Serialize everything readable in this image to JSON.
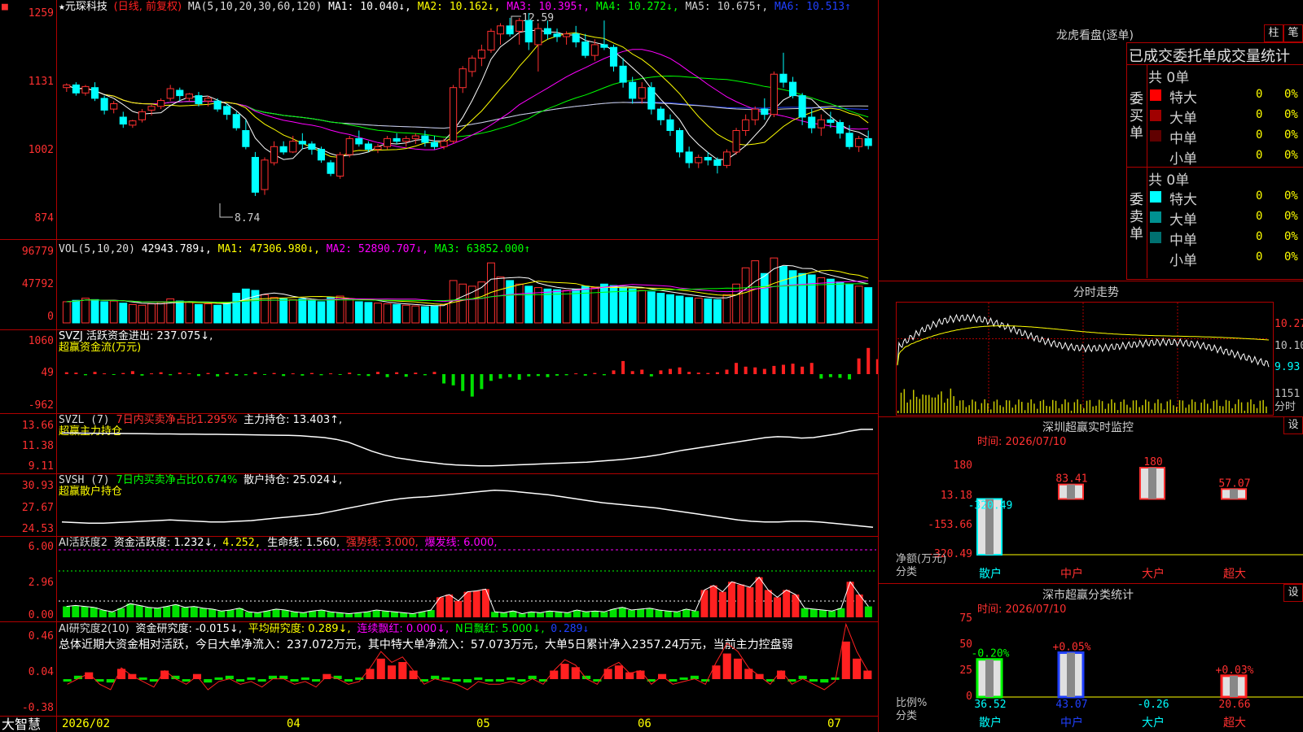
{
  "main_header": {
    "star": "★",
    "name": "元琛科技",
    "period": "(日线, 前复权)",
    "ma_label": "MA(5,10,20,30,60,120)",
    "ma1": "MA1: 10.040↓,",
    "ma2": "MA2: 10.162↓,",
    "ma3": "MA3: 10.395↑,",
    "ma4": "MA4: 10.272↓,",
    "ma5": "MA5: 10.675↑,",
    "ma6": "MA6: 10.513↑",
    "high_note": "12.59",
    "low_note": "8.74"
  },
  "price_axis": [
    "1259",
    "1131",
    "1002",
    "874"
  ],
  "vol_header": {
    "label": "VOL(5,10,20)",
    "value": "42943.789↓,",
    "ma1": "MA1: 47306.980↓,",
    "ma2": "MA2: 52890.707↓,",
    "ma3": "MA3: 63852.000↑"
  },
  "vol_axis": [
    "96779",
    "47792",
    "0"
  ],
  "svzj": {
    "line1": "SVZJ  活跃资金进出: 237.075↓,",
    "line2": "超赢资金流(万元)",
    "axis": [
      "1060",
      "49",
      "-962"
    ]
  },
  "svzl": {
    "label": "SVZL (7)",
    "net": "7日内买卖净占比1.295%",
    "hold": "主力持仓: 13.403↑,",
    "line2": "超赢主力持仓",
    "axis": [
      "13.66",
      "11.38",
      "9.11"
    ]
  },
  "svsh": {
    "label": "SVSH (7)",
    "net": "7日内买卖净占比0.674%",
    "hold": "散户持仓: 25.024↓,",
    "line2": "超赢散户持仓",
    "axis": [
      "30.93",
      "27.67",
      "24.53"
    ]
  },
  "ai_active": {
    "label": "AI活跃度2",
    "v1": "资金活跃度: 1.232↓,",
    "v2": "4.252,",
    "v3": "生命线: 1.560,",
    "v4": "强势线: 3.000,",
    "v5": "爆发线: 6.000,",
    "axis": [
      "6.00",
      "2.96",
      "0.00"
    ]
  },
  "ai_research": {
    "label": "AI研究度2(10)",
    "v1": "资金研究度: -0.015↓,",
    "v2": "平均研究度: 0.289↓,",
    "v3": "连续飘红: 0.000↓,",
    "v4": "N日飘红: 5.000↓,",
    "v5": "0.289↓",
    "summary": "总体近期大资金相对活跃，今日大单净流入：237.072万元，其中特大单净流入：57.073万元，大单5日累计净入2357.24万元，当前主力控盘弱",
    "axis": [
      "0.46",
      "0.04",
      "-0.38"
    ]
  },
  "date_axis": [
    "2026/02",
    "04",
    "05",
    "06",
    "07"
  ],
  "brand": "大智慧",
  "right": {
    "dragon_title": "龙虎看盘(逐单)",
    "btn_zhu": "柱",
    "btn_bi": "笔",
    "order_header": "已成交委托单成交量统计",
    "buy_side": "委买单",
    "sell_side": "委卖单",
    "buy_total": "共 0单",
    "sell_total": "共 0单",
    "buy_rows": [
      {
        "label": "特大",
        "count": "0",
        "pct": "0%",
        "color": "#ff0000"
      },
      {
        "label": "大单",
        "count": "0",
        "pct": "0%",
        "color": "#a00000"
      },
      {
        "label": "中单",
        "count": "0",
        "pct": "0%",
        "color": "#600000"
      },
      {
        "label": "小单",
        "count": "0",
        "pct": "0%",
        "color": "#000000"
      }
    ],
    "sell_rows": [
      {
        "label": "特大",
        "count": "0",
        "pct": "0%",
        "color": "#00ffff"
      },
      {
        "label": "大单",
        "count": "0",
        "pct": "0%",
        "color": "#009090"
      },
      {
        "label": "中单",
        "count": "0",
        "pct": "0%",
        "color": "#007070"
      },
      {
        "label": "小单",
        "count": "0",
        "pct": "0%",
        "color": "#000000"
      }
    ],
    "intraday_title": "分时走势",
    "intraday_axis": [
      "10.27",
      "10.10",
      "9.93"
    ],
    "intraday_vol": "1151",
    "intraday_tag": "分时",
    "monitor_title": "深圳超赢实时监控",
    "monitor_btn": "设",
    "monitor_time": "时间: 2026/07/10",
    "monitor_axis": [
      "180",
      "13.18",
      "-153.66",
      "-320.49"
    ],
    "monitor_unit": "净额(万元)",
    "monitor_cat_label": "分类",
    "monitor_cats": [
      "散户",
      "中户",
      "大户",
      "超大"
    ],
    "monitor_values": [
      -320.49,
      83.41,
      180,
      57.07
    ],
    "monitor_value_labels": [
      "-320.49",
      "83.41",
      "180",
      "57.07"
    ],
    "class_title": "深市超赢分类统计",
    "class_btn": "设",
    "class_time": "时间: 2026/07/10",
    "class_axis": [
      "75",
      "50",
      "25",
      "0"
    ],
    "class_unit": "比例%",
    "class_cat_label": "分类",
    "class_cats": [
      "散户",
      "中户",
      "大户",
      "超大"
    ],
    "class_values": [
      36.52,
      43.07,
      -0.26,
      20.66
    ],
    "class_value_labels": [
      "36.52",
      "43.07",
      "-0.26",
      "20.66"
    ],
    "class_change_labels": [
      "-0.20%",
      "+0.05%",
      "",
      "+0.03%"
    ]
  },
  "chart_data": {
    "type": "candlestick",
    "candles_ohlc": [
      [
        11.2,
        11.28,
        11.12,
        11.25
      ],
      [
        11.25,
        11.3,
        11.05,
        11.1
      ],
      [
        11.1,
        11.25,
        11.05,
        11.22
      ],
      [
        11.2,
        11.3,
        10.95,
        11.0
      ],
      [
        11.0,
        11.05,
        10.7,
        10.78
      ],
      [
        10.8,
        10.95,
        10.72,
        10.9
      ],
      [
        10.65,
        10.75,
        10.45,
        10.52
      ],
      [
        10.5,
        10.6,
        10.45,
        10.58
      ],
      [
        10.6,
        10.8,
        10.55,
        10.75
      ],
      [
        10.78,
        10.88,
        10.68,
        10.85
      ],
      [
        10.85,
        11.0,
        10.8,
        10.96
      ],
      [
        11.0,
        11.25,
        10.95,
        11.18
      ],
      [
        11.15,
        11.2,
        10.95,
        11.05
      ],
      [
        11.0,
        11.1,
        10.95,
        11.08
      ],
      [
        11.05,
        11.12,
        10.85,
        10.9
      ],
      [
        10.95,
        11.05,
        10.85,
        11.0
      ],
      [
        10.95,
        11.0,
        10.75,
        10.8
      ],
      [
        10.85,
        10.9,
        10.6,
        10.7
      ],
      [
        10.7,
        10.75,
        10.4,
        10.45
      ],
      [
        10.4,
        10.6,
        10.05,
        10.1
      ],
      [
        9.9,
        10.0,
        9.18,
        9.25
      ],
      [
        9.3,
        9.9,
        9.2,
        9.85
      ],
      [
        9.8,
        10.2,
        9.75,
        10.1
      ],
      [
        10.1,
        10.2,
        9.95,
        10.0
      ],
      [
        10.0,
        10.3,
        9.98,
        10.2
      ],
      [
        10.2,
        10.35,
        10.05,
        10.15
      ],
      [
        10.15,
        10.2,
        9.95,
        10.05
      ],
      [
        10.05,
        10.1,
        9.8,
        9.85
      ],
      [
        9.8,
        9.85,
        9.55,
        9.6
      ],
      [
        9.55,
        10.0,
        9.5,
        9.95
      ],
      [
        9.95,
        10.3,
        9.9,
        10.25
      ],
      [
        10.25,
        10.4,
        10.1,
        10.15
      ],
      [
        10.15,
        10.2,
        10.0,
        10.05
      ],
      [
        10.05,
        10.15,
        9.98,
        10.1
      ],
      [
        10.1,
        10.3,
        10.05,
        10.25
      ],
      [
        10.25,
        10.35,
        10.15,
        10.2
      ],
      [
        10.2,
        10.3,
        10.1,
        10.25
      ],
      [
        10.25,
        10.35,
        10.15,
        10.3
      ],
      [
        10.3,
        10.4,
        10.1,
        10.18
      ],
      [
        10.18,
        10.3,
        10.05,
        10.1
      ],
      [
        10.1,
        10.25,
        10.05,
        10.2
      ],
      [
        10.2,
        11.25,
        10.15,
        11.2
      ],
      [
        11.2,
        11.6,
        11.1,
        11.55
      ],
      [
        11.5,
        11.8,
        11.4,
        11.75
      ],
      [
        11.75,
        12.0,
        11.6,
        11.9
      ],
      [
        11.9,
        12.3,
        11.85,
        12.25
      ],
      [
        12.2,
        12.4,
        12.0,
        12.35
      ],
      [
        12.35,
        12.5,
        12.15,
        12.2
      ],
      [
        12.25,
        12.5,
        12.0,
        12.45
      ],
      [
        12.45,
        12.59,
        11.9,
        12.05
      ],
      [
        12.0,
        12.4,
        11.5,
        12.3
      ],
      [
        12.3,
        12.45,
        12.1,
        12.2
      ],
      [
        12.2,
        12.3,
        12.05,
        12.15
      ],
      [
        12.15,
        12.25,
        12.0,
        12.2
      ],
      [
        12.2,
        12.35,
        11.95,
        12.05
      ],
      [
        12.05,
        12.2,
        11.75,
        11.8
      ],
      [
        11.8,
        12.1,
        11.7,
        12.0
      ],
      [
        12.0,
        12.45,
        11.9,
        11.95
      ],
      [
        11.95,
        12.0,
        11.5,
        11.6
      ],
      [
        11.6,
        11.75,
        11.2,
        11.3
      ],
      [
        11.3,
        11.4,
        10.9,
        11.0
      ],
      [
        11.0,
        11.3,
        10.9,
        11.2
      ],
      [
        11.2,
        11.3,
        10.7,
        10.8
      ],
      [
        10.8,
        10.85,
        10.5,
        10.6
      ],
      [
        10.6,
        10.7,
        10.3,
        10.4
      ],
      [
        10.4,
        10.45,
        9.9,
        10.0
      ],
      [
        10.0,
        10.1,
        9.7,
        9.8
      ],
      [
        9.8,
        9.95,
        9.7,
        9.9
      ],
      [
        9.9,
        10.0,
        9.75,
        9.85
      ],
      [
        9.85,
        9.9,
        9.6,
        9.75
      ],
      [
        9.75,
        10.05,
        9.7,
        10.0
      ],
      [
        10.0,
        10.45,
        9.95,
        10.4
      ],
      [
        10.4,
        10.7,
        10.3,
        10.6
      ],
      [
        10.6,
        10.85,
        10.5,
        10.8
      ],
      [
        10.8,
        11.0,
        10.6,
        10.7
      ],
      [
        10.7,
        11.5,
        10.65,
        11.45
      ],
      [
        11.45,
        11.85,
        11.2,
        11.3
      ],
      [
        11.3,
        11.4,
        11.0,
        11.05
      ],
      [
        11.05,
        11.1,
        10.5,
        10.65
      ],
      [
        10.65,
        10.8,
        10.35,
        10.45
      ],
      [
        10.45,
        10.7,
        10.3,
        10.6
      ],
      [
        10.6,
        10.75,
        10.45,
        10.55
      ],
      [
        10.55,
        10.6,
        10.25,
        10.35
      ],
      [
        10.35,
        10.5,
        10.05,
        10.1
      ],
      [
        10.1,
        10.3,
        10.0,
        10.25
      ],
      [
        10.25,
        10.4,
        10.05,
        10.12
      ]
    ],
    "volume": [
      30,
      32,
      35,
      33,
      30,
      31,
      28,
      26,
      25,
      27,
      29,
      34,
      31,
      30,
      26,
      27,
      25,
      28,
      42,
      48,
      46,
      40,
      36,
      34,
      33,
      34,
      32,
      30,
      36,
      38,
      34,
      30,
      29,
      28,
      27,
      26,
      25,
      24,
      23,
      24,
      26,
      60,
      55,
      52,
      58,
      85,
      65,
      60,
      55,
      52,
      50,
      48,
      47,
      46,
      48,
      52,
      50,
      55,
      53,
      50,
      48,
      46,
      44,
      42,
      40,
      38,
      36,
      35,
      34,
      33,
      40,
      55,
      78,
      88,
      70,
      92,
      80,
      74,
      70,
      68,
      64,
      62,
      58,
      55,
      52,
      50
    ],
    "vol_ma": [
      {
        "name": "MA1",
        "values_note": "5-day"
      },
      {
        "name": "MA2",
        "values_note": "10-day"
      },
      {
        "name": "MA3",
        "values_note": "20-day"
      }
    ],
    "capital_flow": [
      5,
      4,
      -3,
      6,
      2,
      -2,
      3,
      8,
      -4,
      2,
      5,
      -3,
      4,
      2,
      -5,
      3,
      -6,
      4,
      -4,
      -3,
      5,
      -2,
      3,
      -5,
      2,
      -4,
      3,
      -3,
      2,
      -2,
      4,
      -3,
      -5,
      6,
      -8,
      5,
      -7,
      4,
      -3,
      6,
      -25,
      -30,
      -45,
      -60,
      -40,
      -18,
      -12,
      -8,
      -15,
      -6,
      -5,
      -8,
      -4,
      -3,
      2,
      -4,
      3,
      -3,
      10,
      35,
      8,
      12,
      -6,
      10,
      14,
      18,
      6,
      4,
      3,
      5,
      12,
      30,
      20,
      18,
      14,
      22,
      25,
      28,
      20,
      30,
      -12,
      -8,
      -10,
      -14,
      42,
      70,
      40,
      30
    ],
    "main_hold": [
      13.0,
      13.0,
      12.98,
      12.97,
      12.95,
      12.95,
      12.94,
      12.92,
      12.9,
      12.9,
      12.88,
      12.88,
      12.86,
      12.86,
      12.84,
      12.82,
      12.8,
      12.78,
      12.76,
      12.75,
      12.7,
      12.6,
      12.5,
      12.3,
      12.0,
      11.5,
      11.0,
      10.6,
      10.3,
      10.1,
      9.9,
      9.75,
      9.6,
      9.5,
      9.45,
      9.4,
      9.4,
      9.45,
      9.5,
      9.55,
      9.6,
      9.65,
      9.7,
      9.75,
      9.8,
      9.9,
      10.0,
      10.1,
      10.25,
      10.4,
      10.6,
      10.85,
      11.1,
      11.3,
      11.5,
      11.7,
      11.9,
      12.1,
      12.3,
      12.5,
      12.6,
      12.55,
      12.45,
      12.5,
      12.7,
      12.9,
      13.2,
      13.4,
      13.4
    ],
    "retail_hold": [
      25.8,
      25.7,
      25.6,
      25.6,
      25.7,
      25.8,
      25.9,
      26.0,
      26.1,
      26.0,
      25.9,
      25.8,
      25.8,
      25.9,
      26.0,
      26.2,
      26.4,
      26.6,
      26.8,
      27.0,
      27.4,
      27.8,
      28.2,
      28.6,
      29.0,
      29.3,
      29.5,
      29.6,
      29.8,
      30.0,
      30.2,
      30.4,
      30.6,
      30.5,
      30.3,
      30.1,
      29.9,
      29.6,
      29.3,
      29.0,
      28.7,
      28.5,
      28.3,
      28.1,
      27.9,
      27.6,
      27.3,
      27.0,
      26.7,
      26.4,
      26.1,
      25.9,
      25.8,
      25.8,
      25.9,
      25.9,
      25.8,
      25.6,
      25.4,
      25.2,
      25.0
    ],
    "ai_activity": [
      1.2,
      1.3,
      1.2,
      1.1,
      0.8,
      0.6,
      1.0,
      1.5,
      1.3,
      1.1,
      1.0,
      1.2,
      1.4,
      1.1,
      1.2,
      1.0,
      0.9,
      0.7,
      0.8,
      1.0,
      0.6,
      0.5,
      0.7,
      0.9,
      0.8,
      0.6,
      0.5,
      0.7,
      0.8,
      0.6,
      0.5,
      0.4,
      0.5,
      0.6,
      0.8,
      0.7,
      0.6,
      0.5,
      0.4,
      0.6,
      0.8,
      2.2,
      2.5,
      1.8,
      2.8,
      2.9,
      3.1,
      0.6,
      0.5,
      0.7,
      0.4,
      0.6,
      0.5,
      0.7,
      0.6,
      0.5,
      0.8,
      0.6,
      0.7,
      0.6,
      0.9,
      1.1,
      0.8,
      0.9,
      1.0,
      0.8,
      0.7,
      0.6,
      0.9,
      0.7,
      3.0,
      3.5,
      2.8,
      3.9,
      3.6,
      3.3,
      4.4,
      3.0,
      2.2,
      3.0,
      2.5,
      1.0,
      0.9,
      0.8,
      0.7,
      1.0,
      3.9,
      2.5,
      1.2
    ],
    "ai_research": [
      0.0,
      0.02,
      0.04,
      0.0,
      -0.02,
      0.06,
      0.03,
      0.01,
      -0.01,
      0.05,
      0.02,
      0.0,
      0.03,
      -0.02,
      0.01,
      0.02,
      0.0,
      0.01,
      -0.01,
      0.02,
      0.02,
      0.0,
      0.01,
      -0.01,
      0.03,
      0.02,
      0.0,
      0.01,
      0.06,
      0.12,
      0.08,
      0.1,
      0.05,
      0.0,
      0.02,
      0.01,
      0.0,
      -0.02,
      0.01,
      0.0,
      0.0,
      0.01,
      0.0,
      0.02,
      0.0,
      0.05,
      0.09,
      0.07,
      0.02,
      0.0,
      0.06,
      0.08,
      0.04,
      0.05,
      0.0,
      0.03,
      0.0,
      0.01,
      0.02,
      0.0,
      0.08,
      0.15,
      0.12,
      0.06,
      0.03,
      0.0,
      0.05,
      0.0,
      0.02,
      0.0,
      -0.02,
      0.01,
      0.22,
      0.12,
      0.05
    ],
    "intraday_range": [
      9.93,
      10.27
    ],
    "monitor": {
      "categories": [
        "散户",
        "中户",
        "大户",
        "超大"
      ],
      "values": [
        -320.49,
        83.41,
        180,
        57.07
      ],
      "ylim": [
        -320.49,
        180
      ]
    },
    "classification": {
      "categories": [
        "散户",
        "中户",
        "大户",
        "超大"
      ],
      "values": [
        36.52,
        43.07,
        -0.26,
        20.66
      ],
      "ylim": [
        0,
        75
      ]
    }
  }
}
